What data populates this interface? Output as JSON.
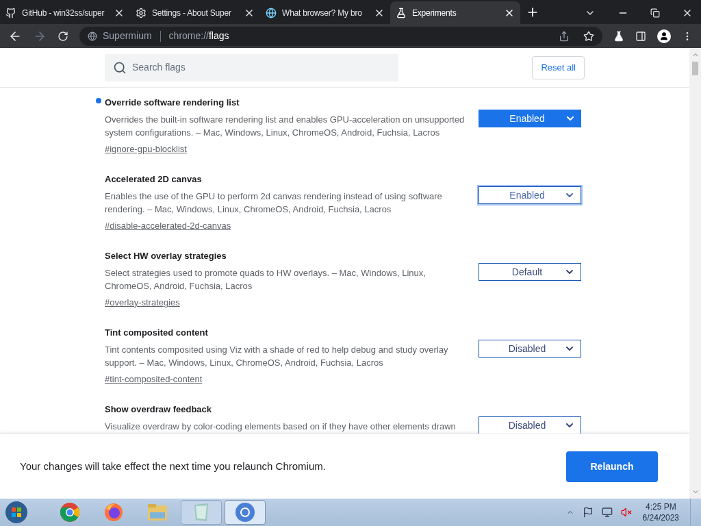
{
  "tabs": [
    {
      "title": "GitHub - win32ss/super",
      "kind": "github",
      "selected": false
    },
    {
      "title": "Settings - About Super",
      "kind": "gear",
      "selected": false
    },
    {
      "title": "What browser? My bro",
      "kind": "globe",
      "selected": false
    },
    {
      "title": "Experiments",
      "kind": "flask",
      "selected": true
    }
  ],
  "address_bar": {
    "site": "Supermium",
    "url_prefix": "chrome://",
    "url_path": "flags"
  },
  "search": {
    "placeholder": "Search flags"
  },
  "reset_button": "Reset all",
  "flags": [
    {
      "title": "Override software rendering list",
      "description": "Overrides the built-in software rendering list and enables GPU-acceleration on unsupported system configurations. – Mac, Windows, Linux, ChromeOS, Android, Fuchsia, Lacros",
      "link": "#ignore-gpu-blocklist",
      "value": "Enabled",
      "modified": true,
      "focused": false
    },
    {
      "title": "Accelerated 2D canvas",
      "description": "Enables the use of the GPU to perform 2d canvas rendering instead of using software rendering. – Mac, Windows, Linux, ChromeOS, Android, Fuchsia, Lacros",
      "link": "#disable-accelerated-2d-canvas",
      "value": "Enabled",
      "modified": false,
      "focused": true
    },
    {
      "title": "Select HW overlay strategies",
      "description": "Select strategies used to promote quads to HW overlays. – Mac, Windows, Linux, ChromeOS, Android, Fuchsia, Lacros",
      "link": "#overlay-strategies",
      "value": "Default",
      "modified": false,
      "focused": false
    },
    {
      "title": "Tint composited content",
      "description": "Tint contents composited using Viz with a shade of red to help debug and study overlay support. – Mac, Windows, Linux, ChromeOS, Android, Fuchsia, Lacros",
      "link": "#tint-composited-content",
      "value": "Disabled",
      "modified": false,
      "focused": false
    },
    {
      "title": "Show overdraw feedback",
      "description": "Visualize overdraw by color-coding elements based on if they have other elements drawn",
      "value": "Disabled",
      "modified": false,
      "focused": false
    }
  ],
  "footer": {
    "message": "Your changes will take effect the next time you relaunch Chromium.",
    "button": "Relaunch"
  },
  "taskbar": {
    "apps": [
      {
        "kind": "chrome",
        "selected": false
      },
      {
        "kind": "firefox",
        "selected": false
      },
      {
        "kind": "explorer",
        "selected": false
      },
      {
        "kind": "notepad",
        "selected": false
      },
      {
        "kind": "chromium",
        "selected": true
      }
    ],
    "time": "4:25 PM",
    "date": "6/24/2023"
  }
}
